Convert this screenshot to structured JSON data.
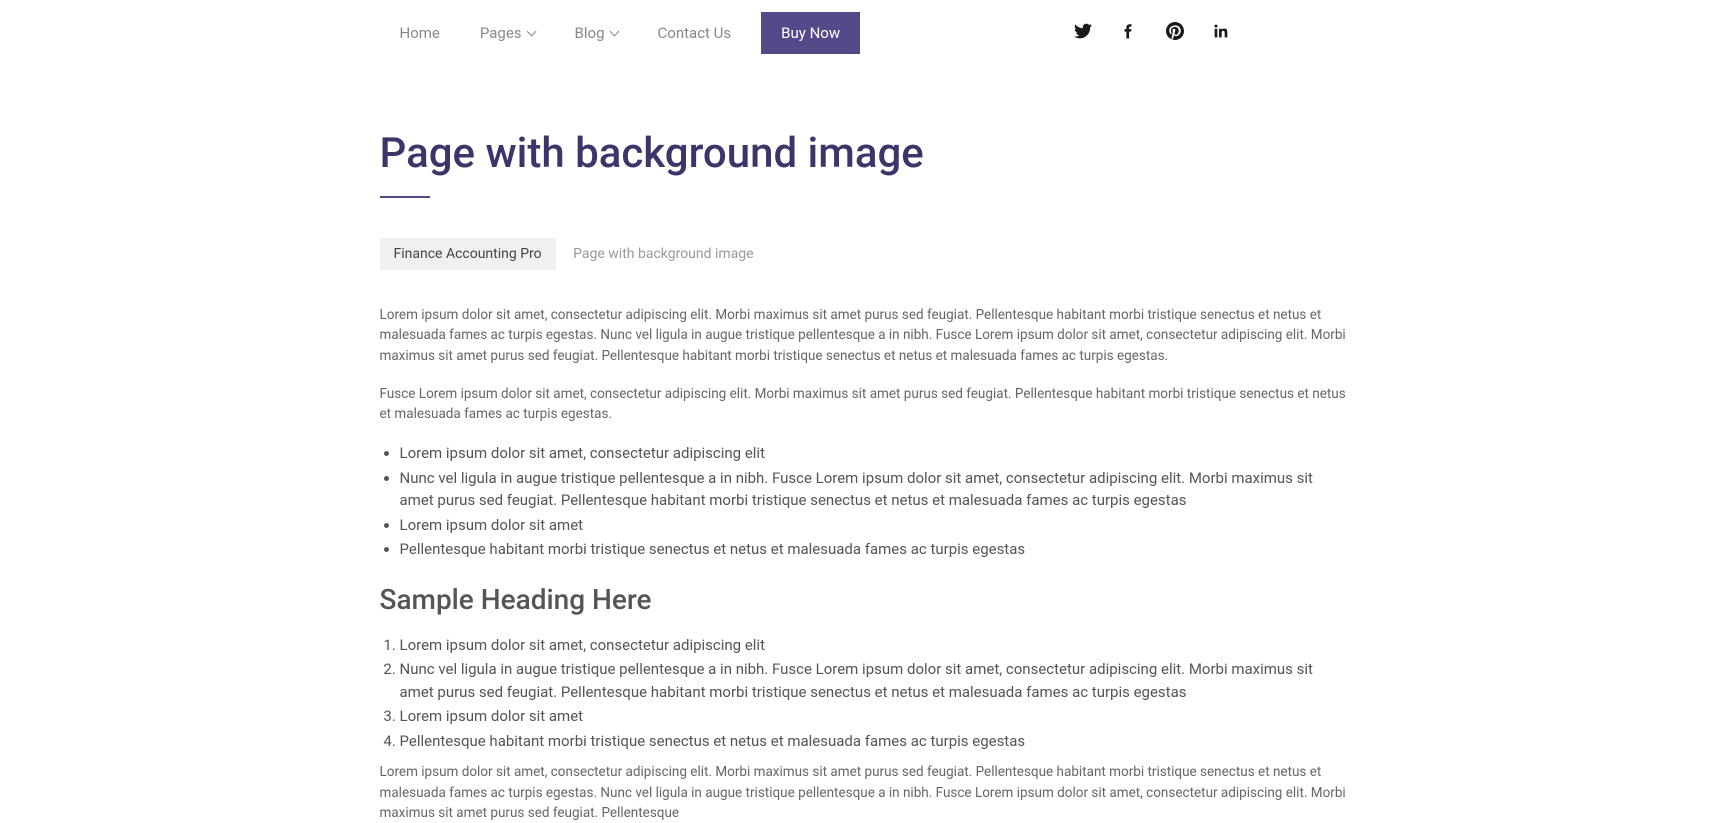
{
  "nav": {
    "home": "Home",
    "pages": "Pages",
    "blog": "Blog",
    "contact": "Contact Us",
    "buy": "Buy Now"
  },
  "page": {
    "title": "Page with background image"
  },
  "breadcrumb": {
    "link": "Finance Accounting Pro",
    "current": "Page with background image"
  },
  "content": {
    "p1": "Lorem ipsum dolor sit amet, consectetur adipiscing elit. Morbi maximus sit amet purus sed feugiat. Pellentesque habitant morbi tristique senectus et netus et malesuada fames ac turpis egestas. Nunc vel ligula in augue tristique pellentesque a in nibh. Fusce Lorem ipsum dolor sit amet, consectetur adipiscing elit. Morbi maximus sit amet purus sed feugiat. Pellentesque habitant morbi tristique senectus et netus et malesuada fames ac turpis egestas.",
    "p2": "Fusce Lorem ipsum dolor sit amet, consectetur adipiscing elit. Morbi maximus sit amet purus sed feugiat. Pellentesque habitant morbi tristique senectus et netus et malesuada fames ac turpis egestas.",
    "ul": [
      "Lorem ipsum dolor sit amet, consectetur adipiscing elit",
      "Nunc vel ligula in augue tristique pellentesque a in nibh. Fusce Lorem ipsum dolor sit amet, consectetur adipiscing elit. Morbi maximus sit amet purus sed feugiat. Pellentesque habitant morbi tristique senectus et netus et malesuada fames ac turpis egestas",
      "Lorem ipsum dolor sit amet",
      "Pellentesque habitant morbi tristique senectus et netus et malesuada fames ac turpis egestas"
    ],
    "h2": "Sample Heading Here",
    "ol": [
      "Lorem ipsum dolor sit amet, consectetur adipiscing elit",
      "Nunc vel ligula in augue tristique pellentesque a in nibh. Fusce Lorem ipsum dolor sit amet, consectetur adipiscing elit. Morbi maximus sit amet purus sed feugiat. Pellentesque habitant morbi tristique senectus et netus et malesuada fames ac turpis egestas",
      "Lorem ipsum dolor sit amet",
      "Pellentesque habitant morbi tristique senectus et netus et malesuada fames ac turpis egestas"
    ],
    "p3": "Lorem ipsum dolor sit amet, consectetur adipiscing elit. Morbi maximus sit amet purus sed feugiat. Pellentesque habitant morbi tristique senectus et netus et malesuada fames ac turpis egestas. Nunc vel ligula in augue tristique pellentesque a in nibh. Fusce Lorem ipsum dolor sit amet, consectetur adipiscing elit. Morbi maximus sit amet purus sed feugiat. Pellentesque"
  }
}
